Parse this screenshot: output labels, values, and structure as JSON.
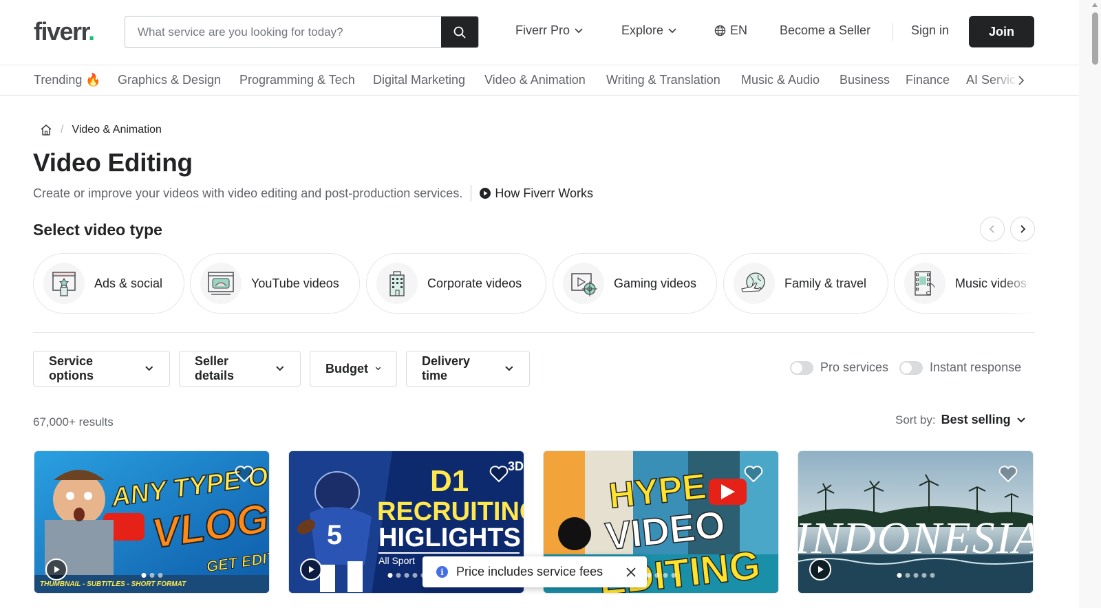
{
  "header": {
    "logo_text": "fiverr",
    "logo_dot": ".",
    "search_placeholder": "What service are you looking for today?",
    "nav": {
      "fiverr_pro": "Fiverr Pro",
      "explore": "Explore",
      "language": "EN",
      "become_seller": "Become a Seller",
      "sign_in": "Sign in",
      "join": "Join"
    }
  },
  "categories": [
    "Trending 🔥",
    "Graphics & Design",
    "Programming & Tech",
    "Digital Marketing",
    "Video & Animation",
    "Writing & Translation",
    "Music & Audio",
    "Business",
    "Finance",
    "AI Servic"
  ],
  "breadcrumb": {
    "current": "Video & Animation"
  },
  "page": {
    "title": "Video Editing",
    "subtitle": "Create or improve your videos with video editing and post-production services.",
    "how_works": "How Fiverr Works",
    "section_title": "Select video type"
  },
  "video_types": [
    {
      "label": "Ads & social",
      "icon": "ads-social-icon"
    },
    {
      "label": "YouTube videos",
      "icon": "youtube-videos-icon"
    },
    {
      "label": "Corporate videos",
      "icon": "corporate-building-icon"
    },
    {
      "label": "Gaming videos",
      "icon": "gaming-target-icon"
    },
    {
      "label": "Family & travel",
      "icon": "globe-plane-icon"
    },
    {
      "label": "Music videos",
      "icon": "film-music-icon"
    }
  ],
  "filters": {
    "service_options": "Service options",
    "seller_details": "Seller details",
    "budget": "Budget",
    "delivery_time": "Delivery time",
    "pro_services": "Pro services",
    "instant_response": "Instant response"
  },
  "results": {
    "count": "67,000+ results",
    "sort_label": "Sort by:",
    "sort_value": "Best selling"
  },
  "cards": [
    {
      "line1": "ANY TYPE OF",
      "line2": "VLOGS",
      "line3": "GET EDITE",
      "footer": "THUMBNAIL - SUBTITLES - SHORT FORMAT"
    },
    {
      "line1": "D1",
      "line2": "RECRUITING",
      "line3": "HIGLIGHTS",
      "footer": "All Sport",
      "corner": "3D"
    },
    {
      "line1": "HYPE",
      "line2": "VIDEO",
      "line3": "EDITING"
    },
    {
      "line1": "INDONESIA"
    }
  ],
  "toast": {
    "text": "Price includes service fees",
    "info": "i"
  },
  "colors": {
    "brand_green": "#1dbf73",
    "dark": "#222325",
    "muted": "#62646a",
    "border": "#e4e5e7"
  }
}
